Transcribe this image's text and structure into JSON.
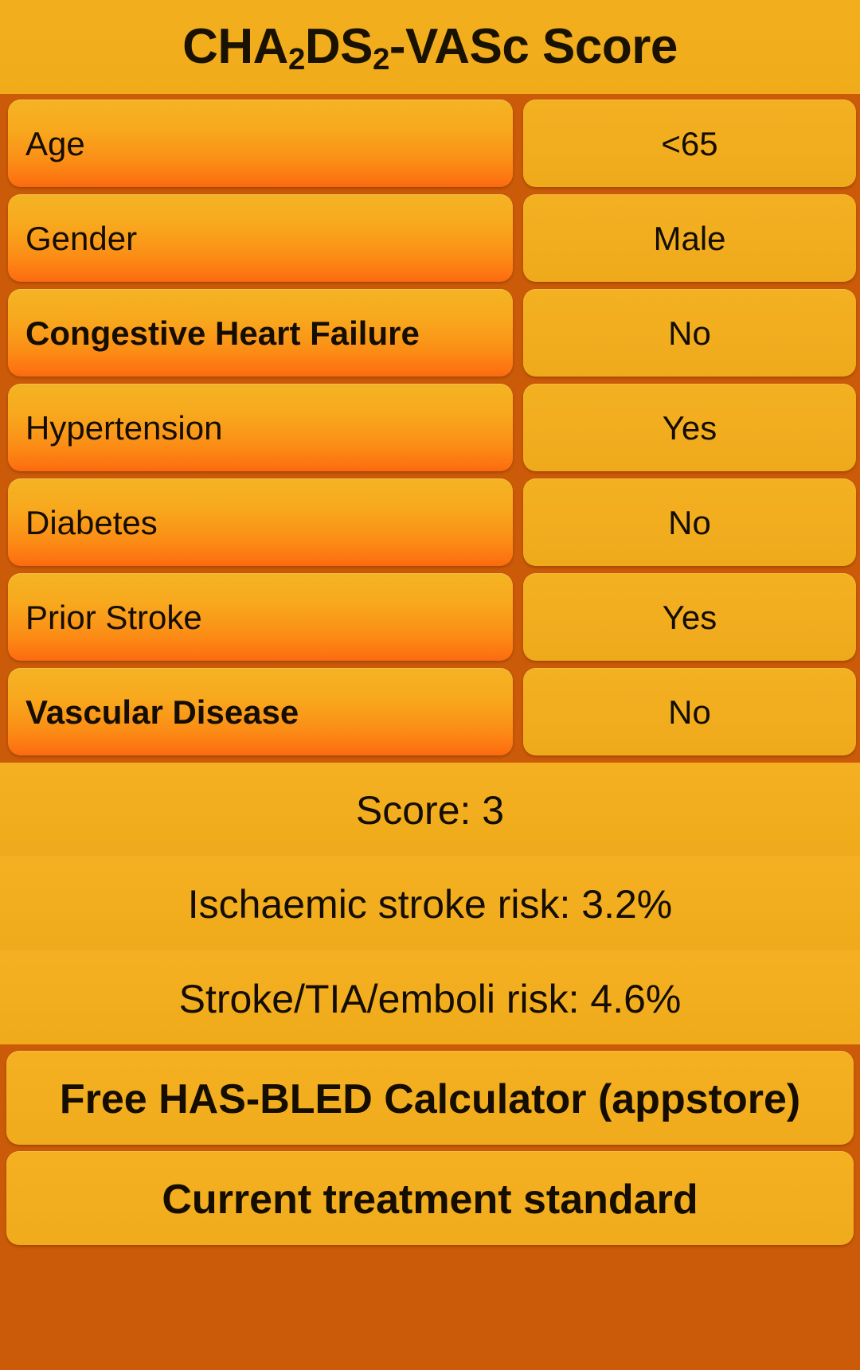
{
  "header": {
    "title_pre": "CHA",
    "title_sub1": "2",
    "title_mid": "DS",
    "title_sub2": "2",
    "title_post": "-VASc Score",
    "title_plain": "CHA2DS2-VASc Score"
  },
  "colors": {
    "background": "#cb5b08",
    "header_bg": "#f2ad1c",
    "factor_button_top": "#f4b424",
    "factor_button_bottom": "#fd7311",
    "value_button": "#f1ad1e",
    "text": "#140d00"
  },
  "rows": [
    {
      "factor": "Age",
      "value": "<65",
      "bold": false
    },
    {
      "factor": "Gender",
      "value": "Male",
      "bold": false
    },
    {
      "factor": "Congestive Heart Failure",
      "value": "No",
      "bold": true
    },
    {
      "factor": "Hypertension",
      "value": "Yes",
      "bold": false
    },
    {
      "factor": "Diabetes",
      "value": "No",
      "bold": false
    },
    {
      "factor": "Prior Stroke",
      "value": "Yes",
      "bold": false
    },
    {
      "factor": "Vascular Disease",
      "value": "No",
      "bold": true
    }
  ],
  "results": {
    "score": "Score: 3",
    "ischaemic_risk": "Ischaemic stroke risk: 3.2%",
    "stroke_tia_risk": "Stroke/TIA/emboli risk: 4.6%"
  },
  "actions": [
    {
      "label": "Free HAS-BLED Calculator (appstore)"
    },
    {
      "label": "Current treatment standard"
    }
  ]
}
